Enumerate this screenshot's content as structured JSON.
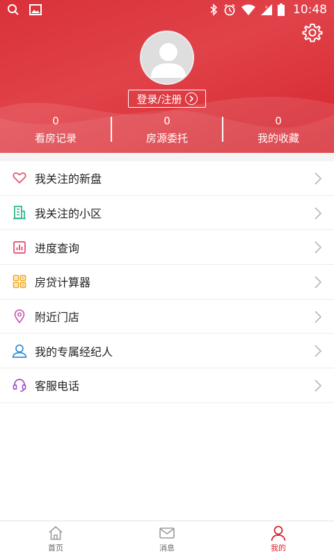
{
  "status_bar": {
    "time": "10:48"
  },
  "profile": {
    "login_label": "登录/注册"
  },
  "stats": [
    {
      "count": "0",
      "label": "看房记录"
    },
    {
      "count": "0",
      "label": "房源委托"
    },
    {
      "count": "0",
      "label": "我的收藏"
    }
  ],
  "menu": [
    {
      "label": "我关注的新盘",
      "icon": "heart-icon"
    },
    {
      "label": "我关注的小区",
      "icon": "building-icon"
    },
    {
      "label": "进度查询",
      "icon": "bar-chart-icon"
    },
    {
      "label": "房贷计算器",
      "icon": "calculator-icon"
    },
    {
      "label": "附近门店",
      "icon": "location-pin-icon"
    },
    {
      "label": "我的专属经纪人",
      "icon": "agent-icon"
    },
    {
      "label": "客服电话",
      "icon": "headset-icon"
    }
  ],
  "tabs": [
    {
      "label": "首页",
      "icon": "home-icon"
    },
    {
      "label": "消息",
      "icon": "mail-icon"
    },
    {
      "label": "我的",
      "icon": "user-icon",
      "active": true
    }
  ],
  "colors": {
    "brand": "#d8232c",
    "header_bg": "#e0393f"
  }
}
